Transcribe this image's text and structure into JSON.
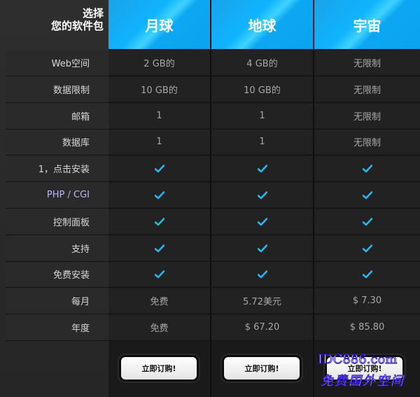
{
  "header": {
    "choose_line1": "选择",
    "choose_line2": "您的软件包",
    "plans": [
      "月球",
      "地球",
      "宇宙"
    ]
  },
  "rows": [
    {
      "label": "Web空间",
      "values": [
        "2 GB的",
        "4 GB的",
        "无限制"
      ]
    },
    {
      "label": "数据限制",
      "values": [
        "10 GB的",
        "10 GB的",
        "无限制"
      ]
    },
    {
      "label": "邮箱",
      "values": [
        "1",
        "1",
        "无限制"
      ]
    },
    {
      "label": "数据库",
      "values": [
        "1",
        "1",
        "无限制"
      ]
    },
    {
      "label": "1，点击安装",
      "values": [
        "check",
        "check",
        "check"
      ]
    },
    {
      "label": "PHP / CGI",
      "values": [
        "check",
        "check",
        "check"
      ]
    },
    {
      "label": "控制面板",
      "values": [
        "check",
        "check",
        "check"
      ]
    },
    {
      "label": "支持",
      "values": [
        "check",
        "check",
        "check"
      ]
    },
    {
      "label": "免费安装",
      "values": [
        "check",
        "check",
        "check"
      ]
    },
    {
      "label": "每月",
      "values": [
        "免费",
        "5.72美元",
        "$ 7.30"
      ]
    },
    {
      "label": "年度",
      "values": [
        "免费",
        "$ 67.20",
        "$ 85.80"
      ]
    }
  ],
  "footer": {
    "buttons": [
      "立即订购!",
      "立即订购!",
      "立即订购!"
    ]
  },
  "watermark": {
    "line1": "IDC886.com",
    "line2": "免费国外空间"
  },
  "colors": {
    "header_blue": "#0fb3ff",
    "check": "#2ab6f0",
    "watermark_outline": "#2a10c8"
  }
}
